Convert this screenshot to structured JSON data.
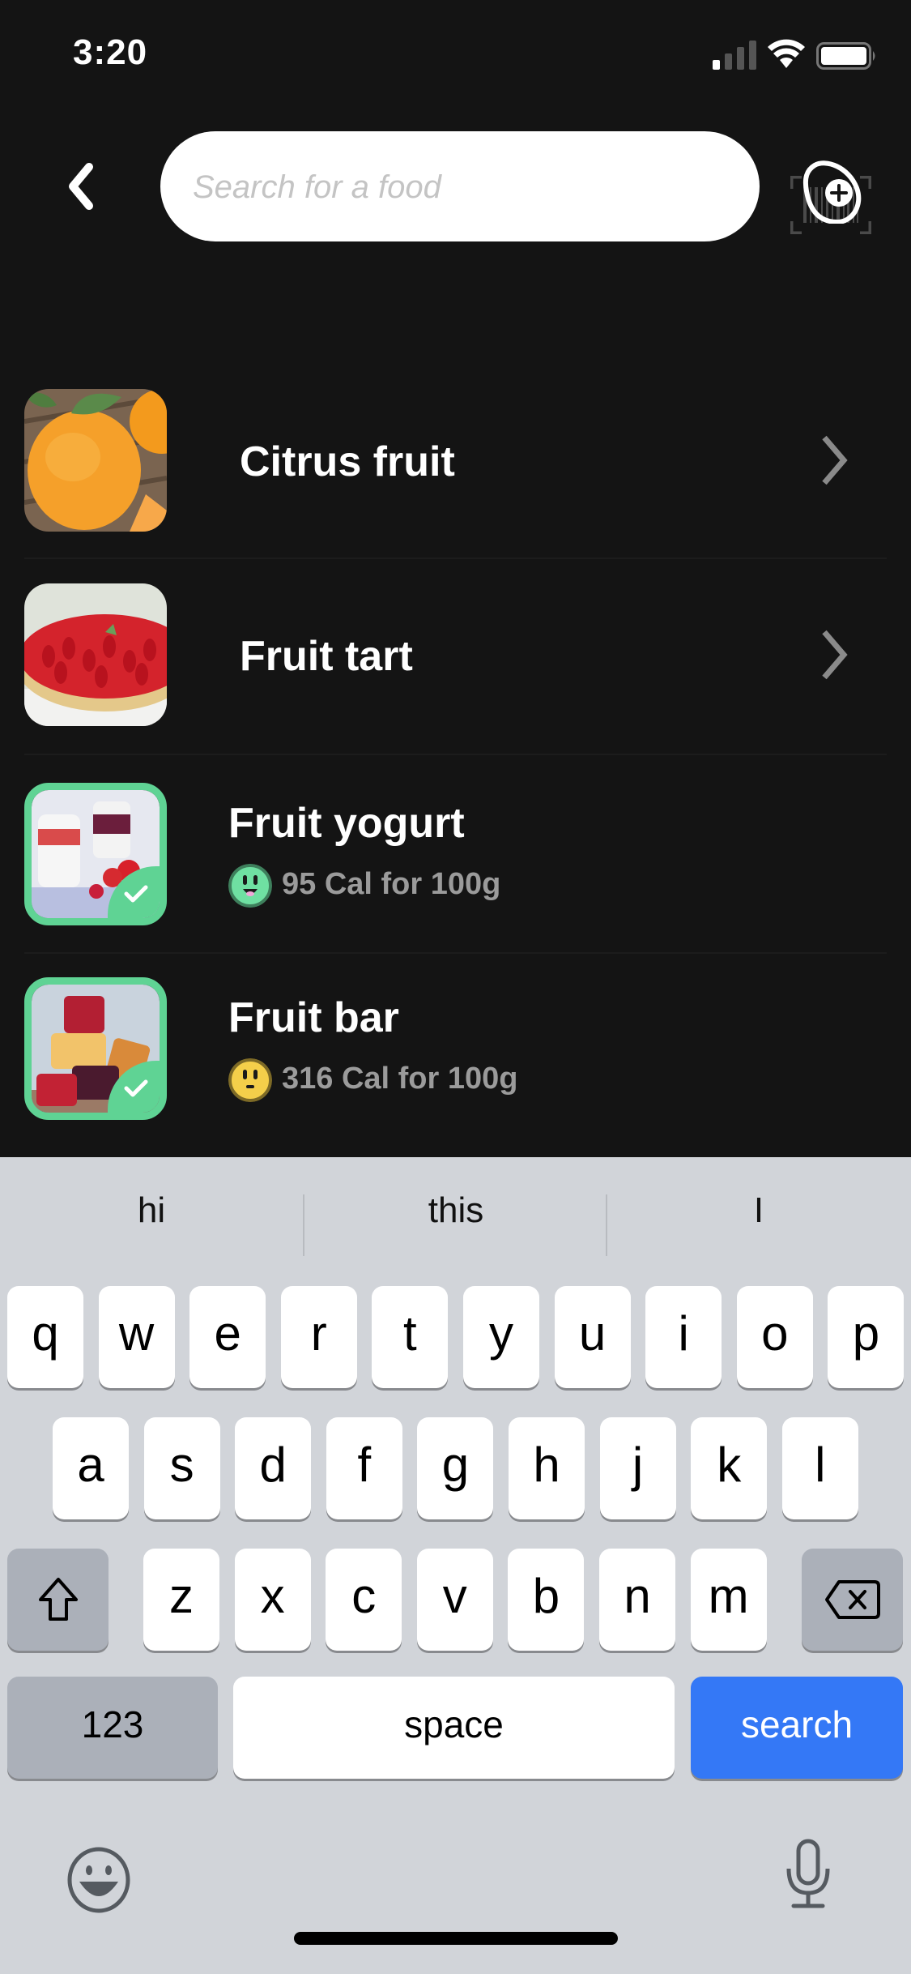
{
  "status_bar": {
    "time": "3:20",
    "signal_bars_active": 1,
    "signal_bars_total": 4
  },
  "header": {
    "back_icon": "chevron-left-icon",
    "search_placeholder": "Search for a food",
    "search_value": "",
    "barcode_icon": "barcode-scan-icon",
    "add_icon": "egg-add-icon"
  },
  "results": [
    {
      "title": "Citrus fruit",
      "subtitle": null,
      "image": "orange",
      "selected": false,
      "has_chevron": true
    },
    {
      "title": "Fruit tart",
      "subtitle": null,
      "image": "strawberry-tart",
      "selected": false,
      "has_chevron": true
    },
    {
      "title": "Fruit yogurt",
      "subtitle": "95 Cal for 100g",
      "rating_face": "happy-green",
      "face_color": "#6fe0a2",
      "image": "yogurt",
      "selected": true,
      "has_chevron": false
    },
    {
      "title": "Fruit bar",
      "subtitle": "316 Cal for 100g",
      "rating_face": "neutral-yellow",
      "face_color": "#f4cf4a",
      "image": "fruit-jellies",
      "selected": true,
      "has_chevron": false
    }
  ],
  "colors": {
    "background": "#141414",
    "selected_border": "#5fd394",
    "keyboard_bg": "#d1d4d9",
    "search_key": "#3478f6"
  },
  "keyboard": {
    "suggestions": [
      "hi",
      "this",
      "I"
    ],
    "row1": [
      "q",
      "w",
      "e",
      "r",
      "t",
      "y",
      "u",
      "i",
      "o",
      "p"
    ],
    "row2": [
      "a",
      "s",
      "d",
      "f",
      "g",
      "h",
      "j",
      "k",
      "l"
    ],
    "row3": [
      "z",
      "x",
      "c",
      "v",
      "b",
      "n",
      "m"
    ],
    "numbers_label": "123",
    "space_label": "space",
    "search_label": "search",
    "shift_icon": "shift-icon",
    "delete_icon": "backspace-icon",
    "emoji_icon": "emoji-icon",
    "mic_icon": "microphone-icon"
  }
}
